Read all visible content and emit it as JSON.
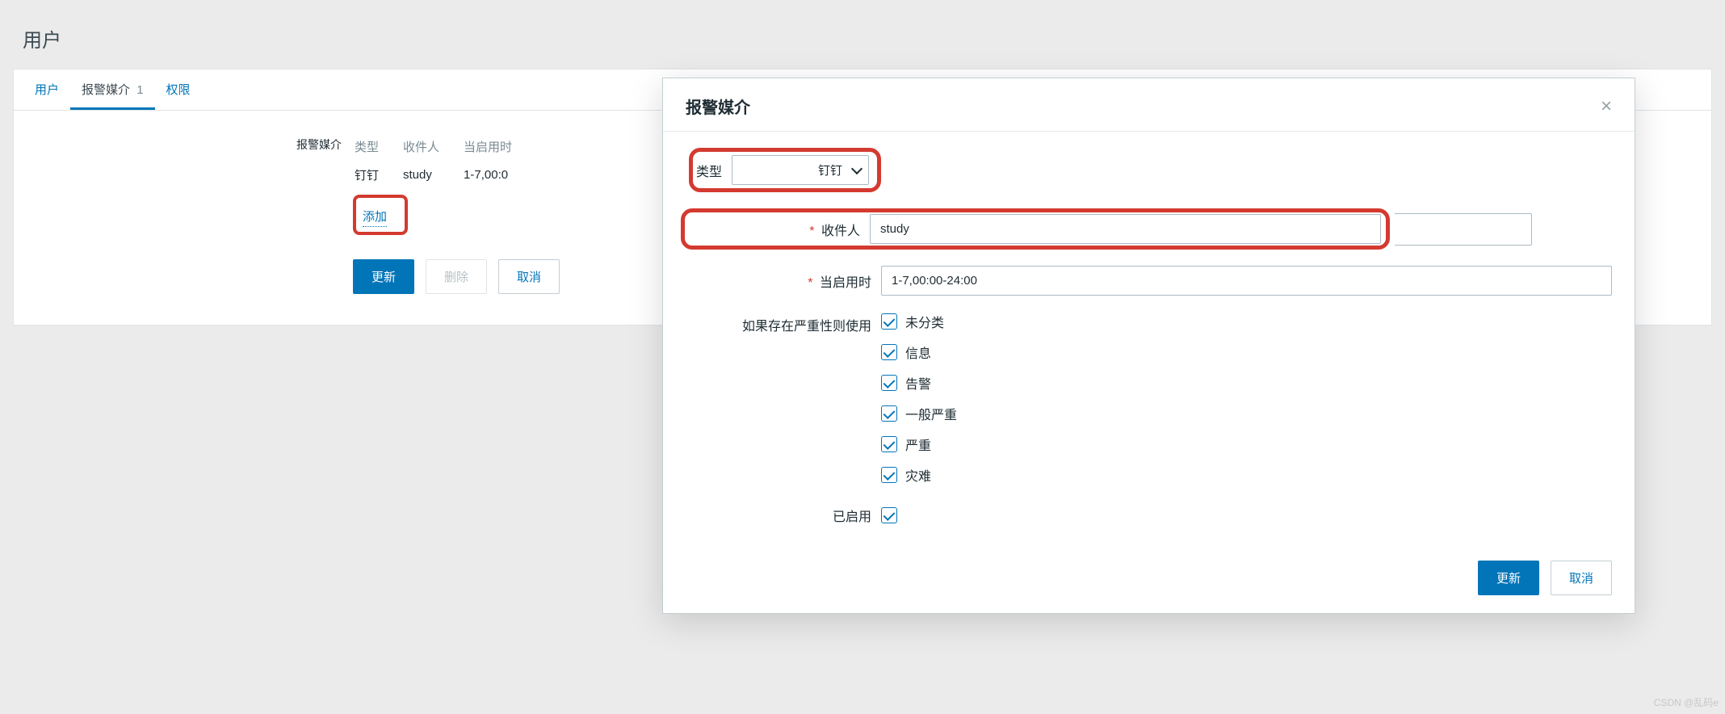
{
  "page_title": "用户",
  "tabs": {
    "user": "用户",
    "media": "报警媒介",
    "media_count": "1",
    "perm": "权限"
  },
  "media_section": {
    "label": "报警媒介",
    "headers": {
      "type": "类型",
      "sendto": "收件人",
      "when": "当启用时"
    },
    "row": {
      "type": "钉钉",
      "sendto": "study",
      "when": "1-7,00:0"
    },
    "add": "添加"
  },
  "buttons": {
    "update": "更新",
    "delete": "删除",
    "cancel": "取消"
  },
  "modal": {
    "title": "报警媒介",
    "fields": {
      "type_label": "类型",
      "type_value": "钉钉",
      "sendto_label": "收件人",
      "sendto_value": "study",
      "when_label": "当启用时",
      "when_value": "1-7,00:00-24:00",
      "severity_label": "如果存在严重性则使用",
      "enabled_label": "已启用"
    },
    "severities": [
      "未分类",
      "信息",
      "告警",
      "一般严重",
      "严重",
      "灾难"
    ],
    "footer": {
      "update": "更新",
      "cancel": "取消"
    }
  },
  "watermark": "CSDN @乱码e"
}
